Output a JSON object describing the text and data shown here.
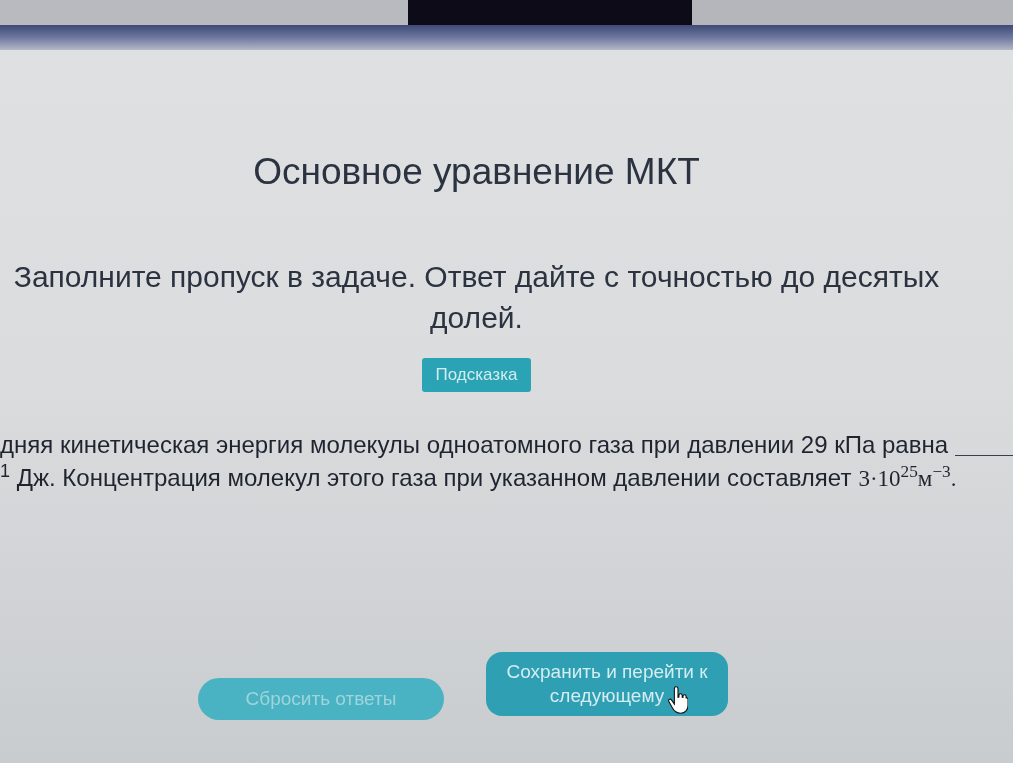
{
  "lesson": {
    "title": "Основное уравнение МКТ",
    "instruction": "Заполните пропуск в задаче. Ответ дайте с точностью до десятых долей.",
    "hint_button": {
      "label": "Подсказка"
    }
  },
  "problem": {
    "lines": [
      {
        "segments": [
          {
            "kind": "text",
            "text": "дняя кинетическая энергия молекулы одноатомного газа при давлении 29 кПа равна"
          },
          {
            "kind": "blank"
          }
        ]
      },
      {
        "segments": [
          {
            "kind": "text",
            "text": "$^{1}$ Дж. Концентрация молекул этого газа при указанном давлении составляет"
          },
          {
            "kind": "formula",
            "text": "3·10$^{25}$м$^{−3}$."
          }
        ]
      }
    ]
  },
  "actions": [
    {
      "label": "Сбросить ответы",
      "disabled": true
    },
    {
      "label": "Сохранить и перейти к следующему",
      "disabled": false
    }
  ]
}
